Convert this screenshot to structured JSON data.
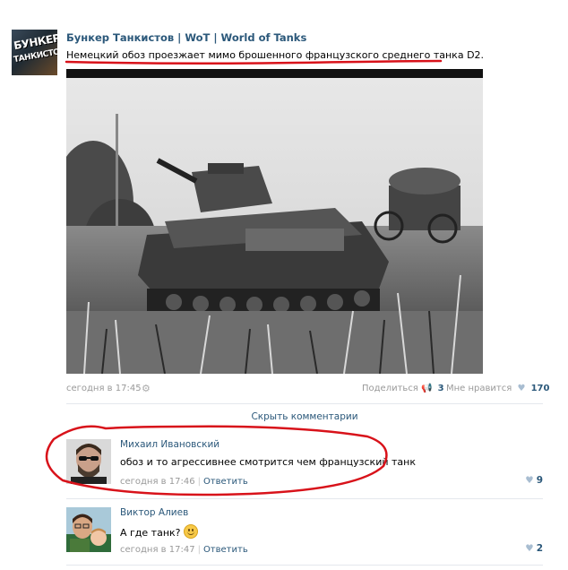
{
  "post": {
    "group_name": "Бункер Танкистов | WoT | World of Tanks",
    "avatar_line1": "БУНКЕР",
    "avatar_line2": "ТАНКИСТОВ",
    "text": "Немецкий обоз проезжает мимо брошенного французского среднего танка D2.",
    "date": "сегодня в 17:45",
    "share_label": "Поделиться",
    "share_count": "3",
    "like_label": "Мне нравится",
    "like_count": "170"
  },
  "comments_toggle": "Скрыть комментарии",
  "comments": [
    {
      "author": "Михаил Ивановский",
      "text": "обоз и то агрессивнее смотрится чем французский танк",
      "date": "сегодня в 17:46",
      "reply": "Ответить",
      "likes": "9"
    },
    {
      "author": "Виктор Алиев",
      "text": "А где танк?",
      "date": "сегодня в 17:47",
      "reply": "Ответить",
      "likes": "2"
    }
  ],
  "colors": {
    "link": "#2b587a",
    "muted": "#999999",
    "annotation": "#d8121a",
    "heart": "#a8bdd1"
  },
  "icons": {
    "settings": "gear-icon",
    "share": "megaphone-icon",
    "like": "heart-icon",
    "emoji": "smile-emoji-icon"
  }
}
